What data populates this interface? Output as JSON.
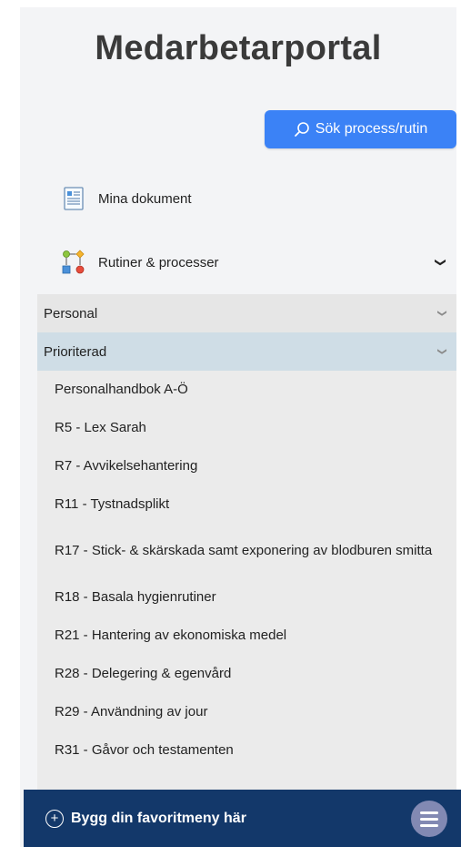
{
  "app": {
    "title": "Medarbetarportal"
  },
  "search": {
    "label": "Sök process/rutin",
    "icon": "search-icon"
  },
  "nav": {
    "my_documents": {
      "label": "Mina dokument",
      "icon": "document-icon"
    },
    "routines": {
      "label": "Rutiner & processer",
      "icon": "process-flow-icon",
      "expanded": true
    },
    "categories": [
      {
        "label": "Personal",
        "expanded": false
      },
      {
        "label": "Prioriterad",
        "expanded": true
      }
    ],
    "prioritized_items": [
      "Personalhandbok A-Ö",
      "R5 - Lex Sarah",
      "R7 - Avvikelsehantering",
      "R11 - Tystnadsplikt",
      "R17 - Stick- & skärskada samt exponering av blodburen smitta",
      "R18 - Basala hygienrutiner",
      "R21 - Hantering av ekonomiska medel",
      "R28 - Delegering & egenvård",
      "R29 - Användning av jour",
      "R31 - Gåvor och testamenten"
    ]
  },
  "footer": {
    "label": "Bygg din favoritmeny här",
    "icon": "plus-circle-icon",
    "menu_icon": "hamburger-menu-icon"
  },
  "colors": {
    "accent": "#3b82f6",
    "footer_bg": "#13386a",
    "selected_category_bg": "#cfdde6"
  }
}
